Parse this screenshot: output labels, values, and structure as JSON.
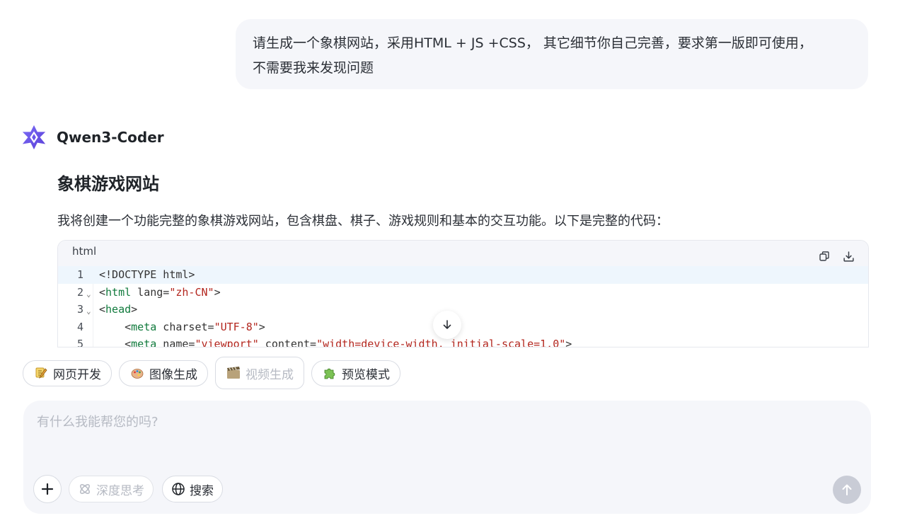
{
  "user_message": {
    "line1": "请生成一个象棋网站，采用HTML + JS +CSS， 其它细节你自己完善，要求第一版即可使用，",
    "line2": "不需要我来发现问题"
  },
  "assistant": {
    "model_name": "Qwen3-Coder",
    "title": "象棋游戏网站",
    "intro": "我将创建一个功能完整的象棋游戏网站，包含棋盘、棋子、游戏规则和基本的交互功能。以下是完整的代码："
  },
  "code_block": {
    "language": "html",
    "lines": [
      {
        "n": "1",
        "parts": [
          [
            "plain",
            "<!DOCTYPE html>"
          ]
        ]
      },
      {
        "n": "2",
        "parts": [
          [
            "plain",
            "<"
          ],
          [
            "tag",
            "html"
          ],
          [
            "plain",
            " lang="
          ],
          [
            "str",
            "\"zh-CN\""
          ],
          [
            "plain",
            ">"
          ]
        ]
      },
      {
        "n": "3",
        "parts": [
          [
            "plain",
            "<"
          ],
          [
            "tag",
            "head"
          ],
          [
            "plain",
            ">"
          ]
        ]
      },
      {
        "n": "4",
        "parts": [
          [
            "plain",
            "    <"
          ],
          [
            "tag",
            "meta"
          ],
          [
            "plain",
            " charset="
          ],
          [
            "str",
            "\"UTF-8\""
          ],
          [
            "plain",
            ">"
          ]
        ]
      },
      {
        "n": "5",
        "parts": [
          [
            "plain",
            "    <"
          ],
          [
            "tag",
            "meta"
          ],
          [
            "plain",
            " name="
          ],
          [
            "str",
            "\"viewport\""
          ],
          [
            "plain",
            " content="
          ],
          [
            "str",
            "\"width=device-width, initial-scale=1.0\""
          ],
          [
            "plain",
            ">"
          ]
        ]
      }
    ]
  },
  "chips": [
    {
      "label": "网页开发",
      "icon": "pencil-icon",
      "disabled": false
    },
    {
      "label": "图像生成",
      "icon": "palette-icon",
      "disabled": false
    },
    {
      "label": "视频生成",
      "icon": "film-icon",
      "disabled": true
    },
    {
      "label": "预览模式",
      "icon": "puzzle-icon",
      "disabled": false
    }
  ],
  "composer": {
    "placeholder": "有什么我能帮您的吗?",
    "deep_think_label": "深度思考",
    "search_label": "搜索"
  },
  "colors": {
    "bubble_bg": "#f5f6fa",
    "tag_green": "#107a3c",
    "string_red": "#b3261e",
    "active_line": "#eef6fd",
    "send_disabled": "#c9ccd6"
  }
}
